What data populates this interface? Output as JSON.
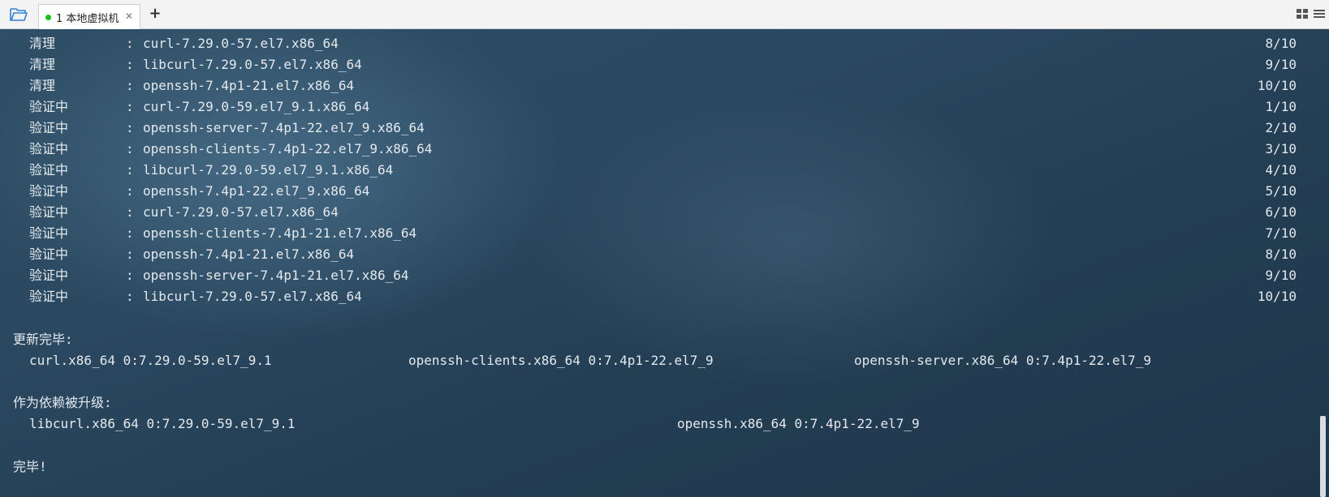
{
  "tabs": [
    {
      "number": "1",
      "label": "本地虚拟机",
      "status_color": "#19c019"
    }
  ],
  "icons": {
    "open": "folder-open-icon",
    "close": "close-icon",
    "add": "plus-icon",
    "layout": "grid-layout-icon",
    "menu": "hamburger-menu-icon"
  },
  "terminal": {
    "rows": [
      {
        "action": "清理",
        "package": "curl-7.29.0-57.el7.x86_64",
        "progress": "8/10"
      },
      {
        "action": "清理",
        "package": "libcurl-7.29.0-57.el7.x86_64",
        "progress": "9/10"
      },
      {
        "action": "清理",
        "package": "openssh-7.4p1-21.el7.x86_64",
        "progress": "10/10"
      },
      {
        "action": "验证中",
        "package": "curl-7.29.0-59.el7_9.1.x86_64",
        "progress": "1/10"
      },
      {
        "action": "验证中",
        "package": "openssh-server-7.4p1-22.el7_9.x86_64",
        "progress": "2/10"
      },
      {
        "action": "验证中",
        "package": "openssh-clients-7.4p1-22.el7_9.x86_64",
        "progress": "3/10"
      },
      {
        "action": "验证中",
        "package": "libcurl-7.29.0-59.el7_9.1.x86_64",
        "progress": "4/10"
      },
      {
        "action": "验证中",
        "package": "openssh-7.4p1-22.el7_9.x86_64",
        "progress": "5/10"
      },
      {
        "action": "验证中",
        "package": "curl-7.29.0-57.el7.x86_64",
        "progress": "6/10"
      },
      {
        "action": "验证中",
        "package": "openssh-clients-7.4p1-21.el7.x86_64",
        "progress": "7/10"
      },
      {
        "action": "验证中",
        "package": "openssh-7.4p1-21.el7.x86_64",
        "progress": "8/10"
      },
      {
        "action": "验证中",
        "package": "openssh-server-7.4p1-21.el7.x86_64",
        "progress": "9/10"
      },
      {
        "action": "验证中",
        "package": "libcurl-7.29.0-57.el7.x86_64",
        "progress": "10/10"
      }
    ],
    "updated_heading": "更新完毕:",
    "updated_packages": [
      "curl.x86_64 0:7.29.0-59.el7_9.1",
      "openssh-clients.x86_64 0:7.4p1-22.el7_9",
      "openssh-server.x86_64 0:7.4p1-22.el7_9"
    ],
    "dependency_heading": "作为依赖被升级:",
    "dependency_packages": [
      "libcurl.x86_64 0:7.29.0-59.el7_9.1",
      "openssh.x86_64 0:7.4p1-22.el7_9"
    ],
    "complete": "完毕!"
  }
}
